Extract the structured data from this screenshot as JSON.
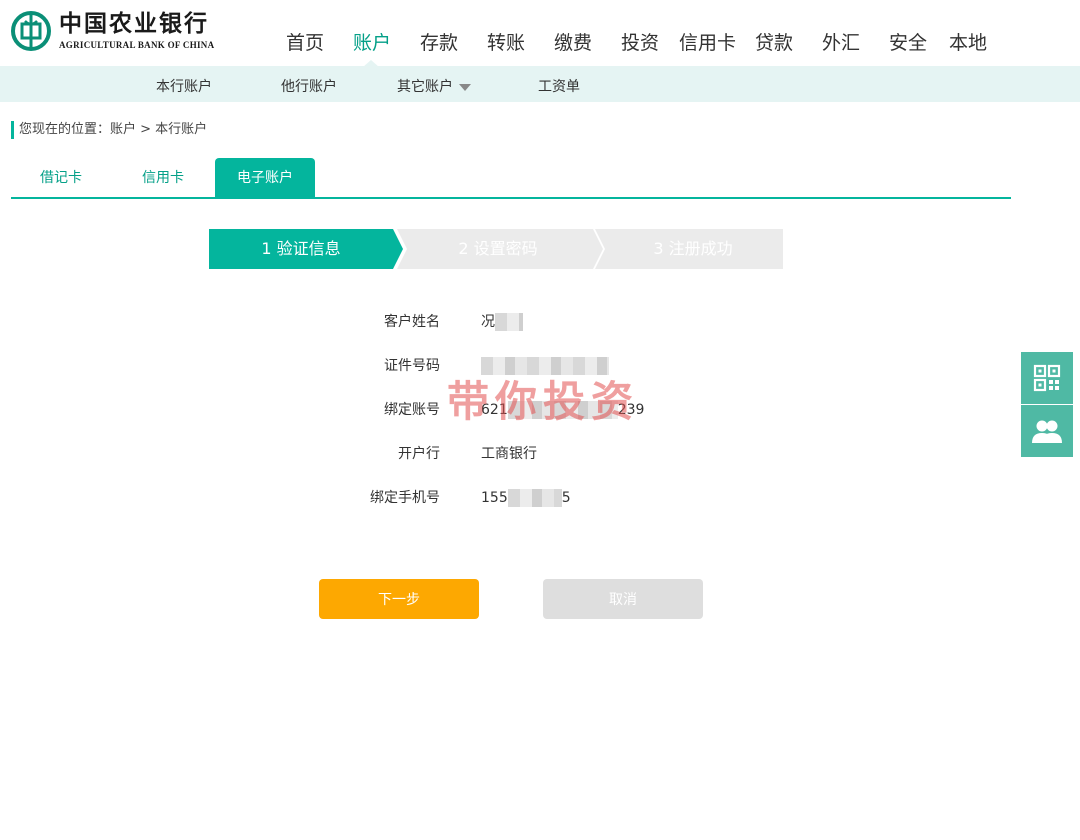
{
  "header": {
    "logo_cn": "中国农业银行",
    "logo_en": "AGRICULTURAL BANK OF CHINA"
  },
  "main_nav": [
    {
      "label": "首页",
      "active": false
    },
    {
      "label": "账户",
      "active": true
    },
    {
      "label": "存款",
      "active": false
    },
    {
      "label": "转账",
      "active": false
    },
    {
      "label": "缴费",
      "active": false
    },
    {
      "label": "投资",
      "active": false
    },
    {
      "label": "信用卡",
      "active": false
    },
    {
      "label": "贷款",
      "active": false
    },
    {
      "label": "外汇",
      "active": false
    },
    {
      "label": "安全",
      "active": false
    },
    {
      "label": "本地",
      "active": false
    }
  ],
  "sub_nav": [
    {
      "label": "本行账户"
    },
    {
      "label": "他行账户"
    },
    {
      "label": "其它账户",
      "has_dropdown": true
    },
    {
      "label": "工资单"
    }
  ],
  "breadcrumb": {
    "prefix": "您现在的位置：",
    "path": "账户 > 本行账户"
  },
  "tabs": [
    {
      "label": "借记卡",
      "active": false
    },
    {
      "label": "信用卡",
      "active": false
    },
    {
      "label": "电子账户",
      "active": true
    }
  ],
  "steps": [
    {
      "label": "1 验证信息",
      "active": true
    },
    {
      "label": "2 设置密码",
      "active": false
    },
    {
      "label": "3 注册成功",
      "active": false
    }
  ],
  "form": {
    "name": {
      "label": "客户姓名",
      "value": "况"
    },
    "id_number": {
      "label": "证件号码",
      "value": ""
    },
    "account": {
      "label": "绑定账号",
      "value_start": "621",
      "value_end": "239"
    },
    "bank": {
      "label": "开户行",
      "value": "工商银行"
    },
    "phone": {
      "label": "绑定手机号",
      "value_start": "155",
      "value_end": "5"
    }
  },
  "watermark": "带你投资",
  "buttons": {
    "next": "下一步",
    "cancel": "取消"
  },
  "colors": {
    "brand": "#04b59d",
    "active_text": "#04a088",
    "subnav_bg": "#e5f4f3",
    "next_button": "#fda801",
    "cancel_button": "#dedede",
    "side_tool": "#4fb9a4",
    "step_inactive": "#ebebeb"
  },
  "side_tools": [
    {
      "icon": "qrcode-icon"
    },
    {
      "icon": "customer-service-icon"
    }
  ]
}
